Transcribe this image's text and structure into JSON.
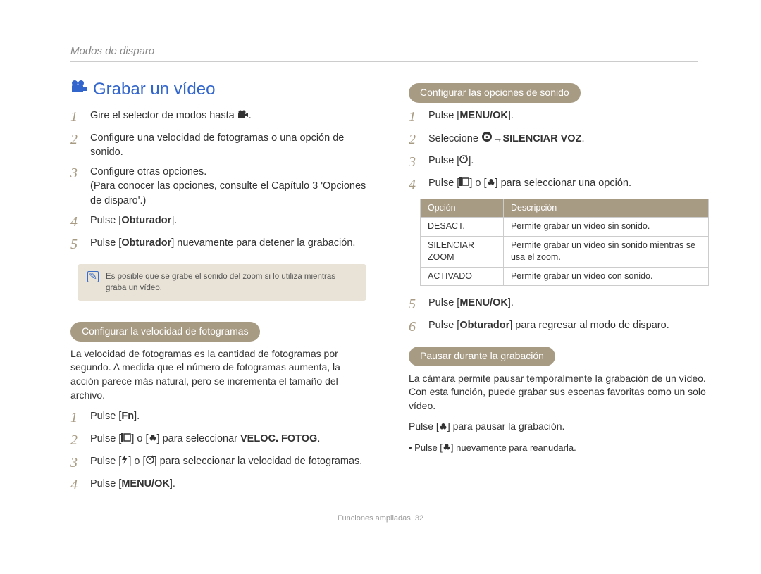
{
  "header": {
    "section": "Modos de disparo"
  },
  "left": {
    "title": "Grabar un vídeo",
    "steps": [
      {
        "n": "1",
        "pre": "Gire el selector de modos hasta ",
        "icon": "video-mode-icon",
        "post": "."
      },
      {
        "n": "2",
        "text": "Configure una velocidad de fotogramas o una opción de sonido."
      },
      {
        "n": "3",
        "text": "Configure otras opciones.\n(Para conocer las opciones, consulte el Capítulo 3 'Opciones de disparo'.)"
      },
      {
        "n": "4",
        "pre": "Pulse [",
        "bold": "Obturador",
        "post": "]."
      },
      {
        "n": "5",
        "pre": "Pulse [",
        "bold": "Obturador",
        "post": "] nuevamente para detener la grabación."
      }
    ],
    "note": "Es posible que se grabe el sonido del zoom si lo utiliza mientras graba un vídeo.",
    "subhead1": "Configurar la velocidad de fotogramas",
    "para1": "La velocidad de fotogramas es la cantidad de fotogramas por segundo. A medida que el número de fotogramas aumenta, la acción parece más natural, pero se incrementa el tamaño del archivo.",
    "fn_steps": [
      {
        "n": "1",
        "pre": "Pulse [",
        "bold": "Fn",
        "post": "]."
      },
      {
        "n": "2",
        "pre": "Pulse [",
        "icon1": "display-icon",
        "mid": "] o [",
        "icon2": "macro-icon",
        "post": "] para seleccionar ",
        "bold": "VELOC. FOTOG",
        "post2": "."
      },
      {
        "n": "3",
        "pre": "Pulse [",
        "icon1": "flash-icon",
        "mid": "] o [",
        "icon2": "timer-icon",
        "post": "] para seleccionar la velocidad de fotogramas."
      },
      {
        "n": "4",
        "pre": "Pulse [",
        "bold": "MENU/OK",
        "post": "]."
      }
    ]
  },
  "right": {
    "subhead1": "Configurar las opciones de sonido",
    "steps": [
      {
        "n": "1",
        "pre": "Pulse [",
        "bold": "MENU/OK",
        "post": "]."
      },
      {
        "n": "2",
        "pre": "Seleccione ",
        "icon": "camera-circle-icon",
        "mid": " → ",
        "bold": "SILENCIAR VOZ",
        "post": "."
      },
      {
        "n": "3",
        "pre": "Pulse [",
        "icon": "timer-icon",
        "post": "]."
      },
      {
        "n": "4",
        "pre": "Pulse [",
        "icon1": "display-icon",
        "mid": "] o [",
        "icon2": "macro-icon",
        "post": "] para seleccionar una opción."
      }
    ],
    "table": {
      "head": {
        "opt": "Opción",
        "desc": "Descripción"
      },
      "rows": [
        {
          "opt": "DESACT.",
          "desc": "Permite grabar un vídeo sin sonido."
        },
        {
          "opt": "SILENCIAR ZOOM",
          "desc": "Permite grabar un vídeo sin sonido mientras se usa el zoom."
        },
        {
          "opt": "ACTIVADO",
          "desc": "Permite grabar un vídeo con sonido."
        }
      ]
    },
    "steps2": [
      {
        "n": "5",
        "pre": "Pulse [",
        "bold": "MENU/OK",
        "post": "]."
      },
      {
        "n": "6",
        "pre": "Pulse [",
        "bold": "Obturador",
        "post": "] para regresar al modo de disparo."
      }
    ],
    "subhead2": "Pausar durante la grabación",
    "para2": "La cámara permite pausar temporalmente la grabación de un vídeo. Con esta función, puede grabar sus escenas favoritas como un solo vídeo.",
    "pause_line": {
      "pre": "Pulse [",
      "icon": "macro-icon",
      "post": "] para pausar la grabación."
    },
    "bullet": {
      "pre": "Pulse [",
      "icon": "macro-icon",
      "post": "] nuevamente para reanudarla."
    }
  },
  "footer": {
    "section": "Funciones ampliadas",
    "page": "32"
  }
}
